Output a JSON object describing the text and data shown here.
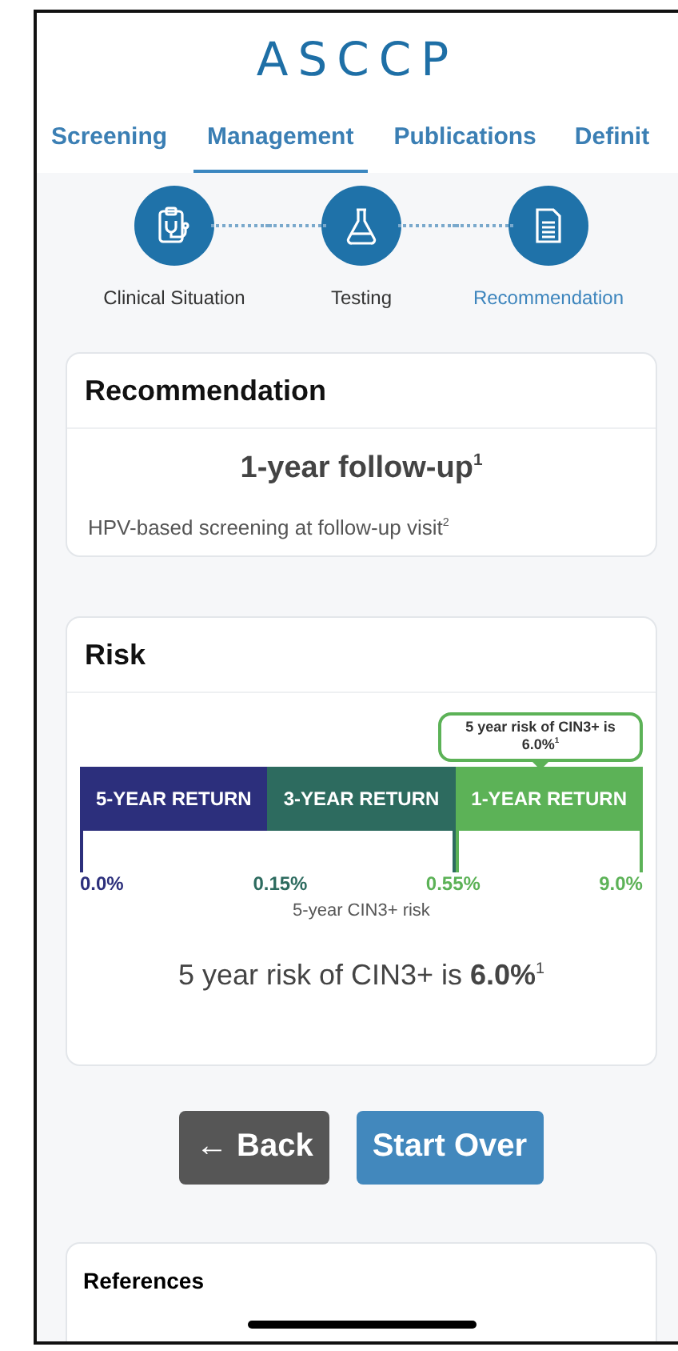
{
  "logo": "ASCCP",
  "tabs": [
    {
      "label": "Screening",
      "selected": false
    },
    {
      "label": "Management",
      "selected": true
    },
    {
      "label": "Publications",
      "selected": false
    },
    {
      "label": "Definit",
      "selected": false
    }
  ],
  "steps": [
    {
      "label": "Clinical Situation",
      "kind": "clipboard",
      "current": false
    },
    {
      "label": "Testing",
      "kind": "flask",
      "current": false
    },
    {
      "label": "Recommendation",
      "kind": "document",
      "current": true
    }
  ],
  "recommendation": {
    "title": "Recommendation",
    "headline": "1-year follow-up$^{1}$",
    "detail": "HPV-based screening at follow-up visit$^{2}$"
  },
  "risk": {
    "title": "Risk",
    "callout": "5 year risk of CIN3+ is 6.0%$^{1}$",
    "segments": [
      {
        "label": "5-YEAR RETURN",
        "color": "#2c2f7c",
        "selected": false
      },
      {
        "label": "3-YEAR RETURN",
        "color": "#2d6b5f",
        "selected": false
      },
      {
        "label": "1-YEAR RETURN",
        "color": "#5cb257",
        "selected": true
      }
    ],
    "ticks": [
      {
        "label": "0.0%",
        "color": "#2c2f7c"
      },
      {
        "label": "0.15%",
        "color": "#2d6b5f"
      },
      {
        "label": "0.55%",
        "color": "#5cb257"
      },
      {
        "label": "9.0%",
        "color": "#5cb257"
      }
    ],
    "axis_label": "5-year CIN3+ risk",
    "summary": "5 year risk of CIN3+ is **6.0%**$^{1}$"
  },
  "buttons": [
    {
      "label": "← Back",
      "kind": "back"
    },
    {
      "label": "Start Over",
      "kind": "primary"
    }
  ],
  "references": {
    "title": "References"
  }
}
